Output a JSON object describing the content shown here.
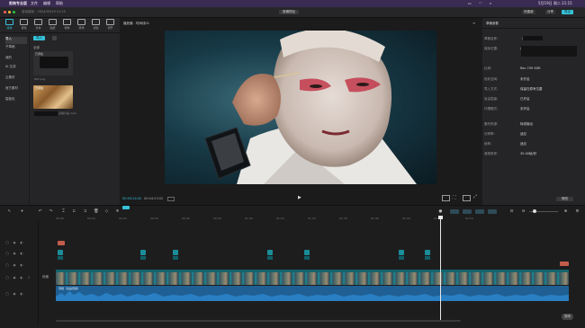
{
  "menubar": {
    "app": "剪映专业版",
    "items": [
      "文件",
      "编辑",
      "帮助"
    ],
    "datetime": "5月19日 周二 21:15"
  },
  "titlebar": {
    "subtitle": "自动保存：2024/05/19 21:15",
    "project": "剪辑项目",
    "buttons": [
      "快捷键",
      "分享",
      "导出"
    ]
  },
  "toolbar": {
    "tabs": [
      "媒体",
      "音频",
      "文本",
      "贴纸",
      "特效",
      "转场",
      "滤镜",
      "调节"
    ]
  },
  "media": {
    "sidebar": [
      "导入",
      "本地",
      "云素材",
      "素材库",
      "AI 生成",
      "品牌素材"
    ],
    "sub_sidebar": [
      "导入",
      "子草稿",
      "我的",
      "AI 生成",
      "云素材",
      "官方素材",
      "智能包"
    ],
    "import_label": "导入",
    "filter_all": "全部",
    "items": [
      {
        "caption": "已添加",
        "file": "RP2.png"
      },
      {
        "caption": "已添加",
        "file": "演唱片段.mp4"
      }
    ]
  },
  "player": {
    "title": "播放器 - 时间线01",
    "timecode_current": "00:00:24:02",
    "timecode_total": "00:04:23:02"
  },
  "details": {
    "title": "草稿参数",
    "rows": [
      {
        "label": "草稿名称：",
        "value": "（草稿名）"
      },
      {
        "label": "保存位置：",
        "value": "/Users/…/JianyingPro"
      },
      {
        "label": "比例：",
        "value": "Rec.709 SDR"
      },
      {
        "label": "色彩空间：",
        "value": "未开启"
      },
      {
        "label": "导入方式：",
        "value": "保留在原有位置"
      },
      {
        "label": "自由层级：",
        "value": "已开启"
      },
      {
        "label": "代理模式：",
        "value": "未开启"
      },
      {
        "label": "素材来源：",
        "value": "转成输出"
      },
      {
        "label": "分辨率：",
        "value": "适应"
      },
      {
        "label": "帧率：",
        "value": "适应"
      },
      {
        "label": "音频采样：",
        "value": "30.00帧/秒"
      }
    ],
    "edit_button": "修改"
  },
  "timeline": {
    "ruler_labels": [
      "00:00",
      "00:10",
      "00:20",
      "00:30",
      "00:40",
      "00:50",
      "01:00",
      "01:10",
      "01:20",
      "01:30",
      "01:40",
      "01:50",
      "02:00",
      "02:10"
    ],
    "video_track_label": "封面",
    "audio_track_label": "音频（这是音频）",
    "watermark": "剪映"
  },
  "colors": {
    "accent": "#36c2d9",
    "menubar": "#3a2b52",
    "audio": "#2a7fc2",
    "video_clip": "#1b8d99",
    "export": "#36c2d9"
  }
}
